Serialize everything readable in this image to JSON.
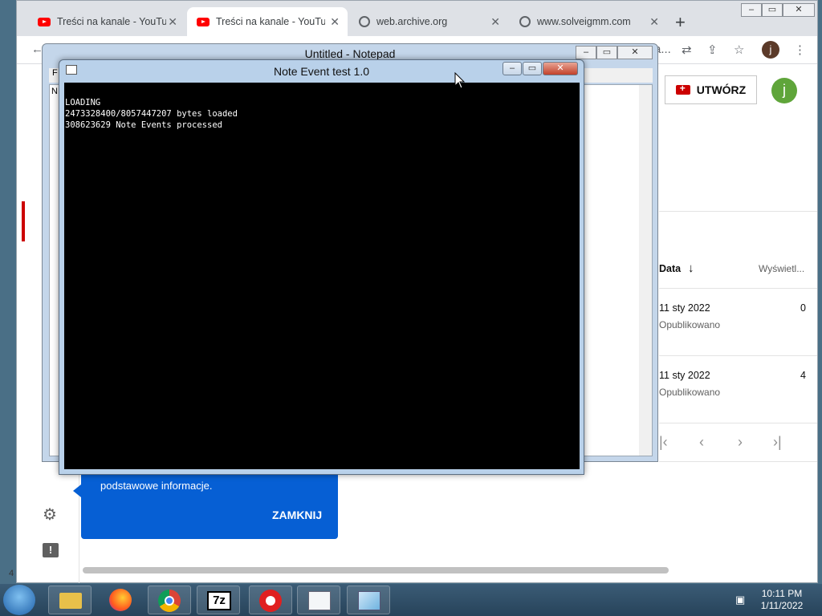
{
  "browser": {
    "tabs": [
      {
        "title": "Treści na kanale - YouTub",
        "icon": "youtube-icon",
        "active": false
      },
      {
        "title": "Treści na kanale - YouTub",
        "icon": "youtube-icon",
        "active": true
      },
      {
        "title": "web.archive.org",
        "icon": "globe-icon",
        "active": false
      },
      {
        "title": "www.solveigmm.com",
        "icon": "globe-icon",
        "active": false
      }
    ],
    "new_tab_label": "+",
    "window_controls": {
      "minimize": "–",
      "maximize": "▭",
      "close": "✕"
    },
    "address_truncated": "a..."
  },
  "studio": {
    "create_label": "UTWÓRZ",
    "avatar_letter": "j",
    "col_date": "Data",
    "col_views": "Wyświetl...",
    "rows": [
      {
        "date": "11 sty 2022",
        "status": "Opublikowano",
        "views": "0"
      },
      {
        "date": "11 sty 2022",
        "status": "Opublikowano",
        "views": "4"
      }
    ],
    "tooltip_text": "podstawowe informacje.",
    "tooltip_close": "ZAMKNIJ"
  },
  "notepad": {
    "title": "Untitled - Notepad",
    "menu_letter": "F",
    "edit_letter": "N"
  },
  "note_event": {
    "title": "Note Event test 1.0",
    "lines": [
      "LOADING",
      "2473328400/8057447207 bytes loaded",
      "308623629 Note Events processed"
    ]
  },
  "taskbar": {
    "time": "10:11 PM",
    "date": "1/11/2022",
    "apps": [
      "explorer-icon",
      "firefox-icon",
      "chrome-icon",
      "7zip-icon",
      "recorder-icon",
      "notepad-app-icon",
      "note-event-app-icon"
    ],
    "sevenzip_label": "7z"
  },
  "misc": {
    "left_edge_digit": "4"
  }
}
